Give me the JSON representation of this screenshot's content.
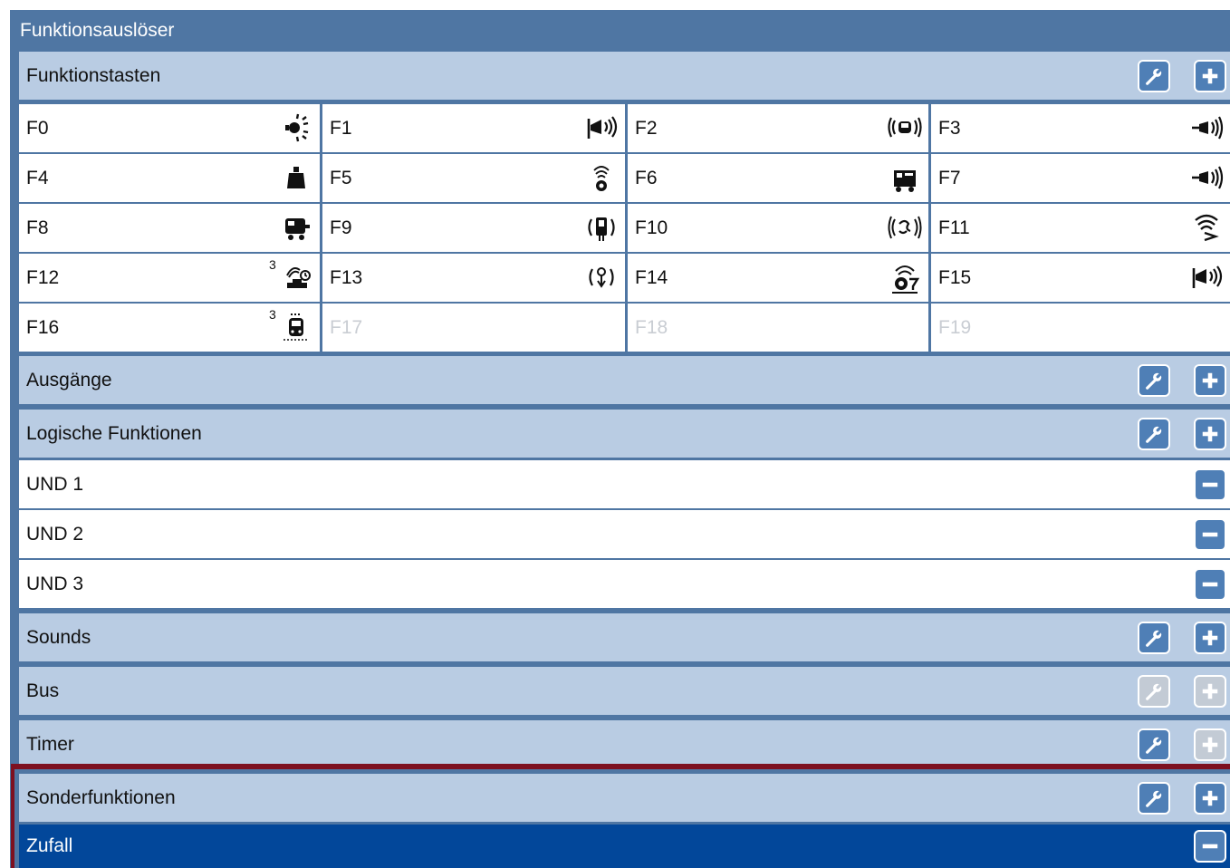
{
  "title": "Funktionsauslöser",
  "sections": {
    "funktionstasten": "Funktionstasten",
    "ausgaenge": "Ausgänge",
    "logische": "Logische Funktionen",
    "sounds": "Sounds",
    "bus": "Bus",
    "timer": "Timer",
    "sonder": "Sonderfunktionen"
  },
  "function_keys": [
    {
      "label": "F0",
      "icon": "light-icon",
      "enabled": true
    },
    {
      "label": "F1",
      "icon": "horn-icon",
      "enabled": true
    },
    {
      "label": "F2",
      "icon": "car-sound-icon",
      "enabled": true
    },
    {
      "label": "F3",
      "icon": "whistle-icon",
      "enabled": true
    },
    {
      "label": "F4",
      "icon": "weight-icon",
      "enabled": true
    },
    {
      "label": "F5",
      "icon": "bell-icon",
      "enabled": true
    },
    {
      "label": "F6",
      "icon": "locomotive-icon",
      "enabled": true
    },
    {
      "label": "F7",
      "icon": "whistle-icon",
      "enabled": true
    },
    {
      "label": "F8",
      "icon": "tender-icon",
      "enabled": true
    },
    {
      "label": "F9",
      "icon": "coupler-sound-icon",
      "enabled": true
    },
    {
      "label": "F10",
      "icon": "fan-sound-icon",
      "enabled": true
    },
    {
      "label": "F11",
      "icon": "signal-icon",
      "enabled": true
    },
    {
      "label": "F12",
      "icon": "steam-timer-icon",
      "badge": "3",
      "enabled": true
    },
    {
      "label": "F13",
      "icon": "pump-sound-icon",
      "enabled": true
    },
    {
      "label": "F14",
      "icon": "bell-stop-icon",
      "enabled": true
    },
    {
      "label": "F15",
      "icon": "horn-icon",
      "enabled": true
    },
    {
      "label": "F16",
      "icon": "tram-icon",
      "badge": "3",
      "enabled": true
    },
    {
      "label": "F17",
      "enabled": false
    },
    {
      "label": "F18",
      "enabled": false
    },
    {
      "label": "F19",
      "enabled": false
    }
  ],
  "logic_items": [
    "UND 1",
    "UND 2",
    "UND 3"
  ],
  "special_items": [
    "Zufall"
  ],
  "colors": {
    "panel": "#4f76a3",
    "section": "#b9cce3",
    "button": "#4f7fb6",
    "button_disabled": "#c3cbd5",
    "selected": "#02479a",
    "highlight_frame": "#7d1020"
  }
}
